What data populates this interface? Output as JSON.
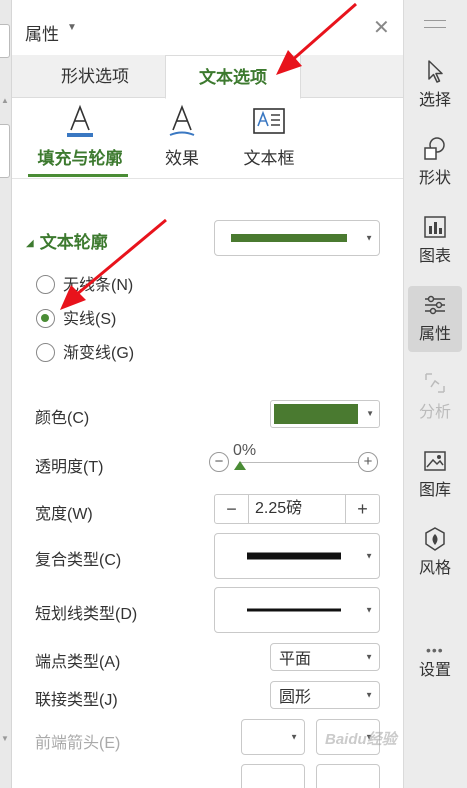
{
  "panel": {
    "title": "属性",
    "main_tabs": [
      "形状选项",
      "文本选项"
    ],
    "sub_tabs": [
      "填充与轮廓",
      "效果",
      "文本框"
    ]
  },
  "outline": {
    "section_title": "文本轮廓",
    "options": [
      "无线条(N)",
      "实线(S)",
      "渐变线(G)"
    ],
    "selected_option": 1
  },
  "props": {
    "color_label": "颜色(C)",
    "color_value": "#4a7a30",
    "transparency_label": "透明度(T)",
    "transparency_value": "0%",
    "width_label": "宽度(W)",
    "width_value": "2.25磅",
    "compound_label": "复合类型(C)",
    "dash_label": "短划线类型(D)",
    "cap_label": "端点类型(A)",
    "cap_value": "平面",
    "join_label": "联接类型(J)",
    "join_value": "圆形",
    "begin_arrow_label": "前端箭头(E)",
    "minus": "−",
    "plus": "+"
  },
  "toolbar": {
    "items": [
      "选择",
      "形状",
      "图表",
      "属性",
      "分析",
      "图库",
      "风格",
      "设置"
    ],
    "active": "属性"
  },
  "colors": {
    "accent": "#3d7a2f",
    "line_color": "#4a7a30",
    "arrow": "#e8131c"
  },
  "watermark": "Baidu经验"
}
